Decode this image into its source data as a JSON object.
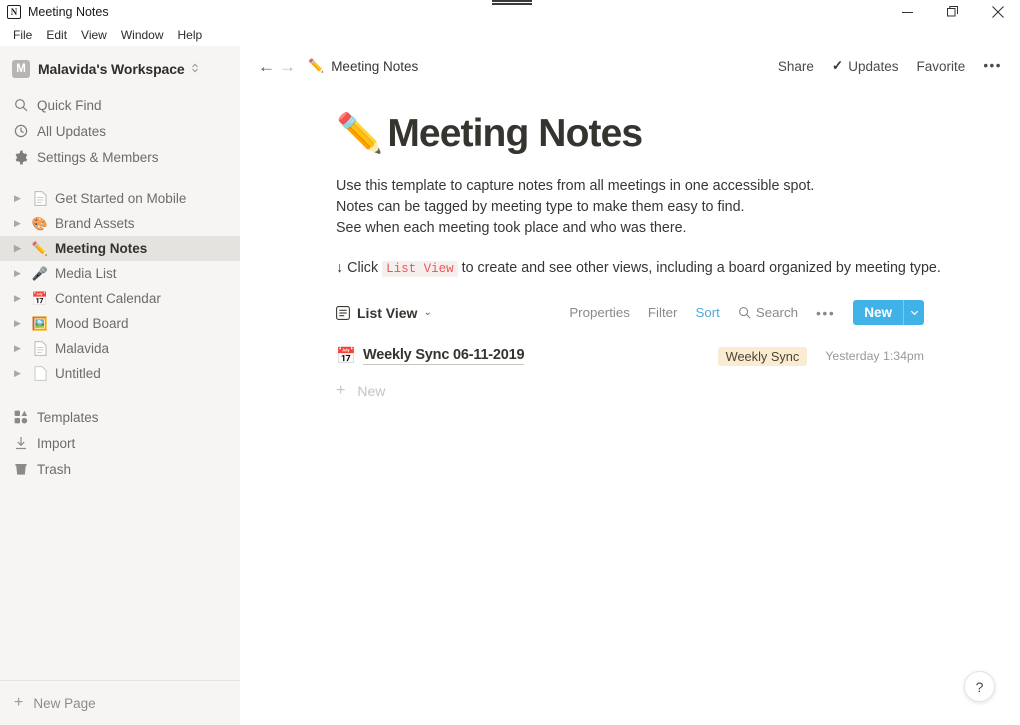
{
  "window": {
    "app_logo": "notion-n-logo",
    "title": "Meeting Notes",
    "minimize": "minimize-icon",
    "restore": "restore-icon",
    "close": "close-icon"
  },
  "menubar": {
    "items": [
      {
        "label": "File"
      },
      {
        "label": "Edit"
      },
      {
        "label": "View"
      },
      {
        "label": "Window"
      },
      {
        "label": "Help"
      }
    ]
  },
  "sidebar": {
    "workspace": {
      "avatar_letter": "M",
      "name": "Malavida's Workspace",
      "caret": "⌃⌄"
    },
    "nav": [
      {
        "label": "Quick Find",
        "icon": "search-icon"
      },
      {
        "label": "All Updates",
        "icon": "clock-icon"
      },
      {
        "label": "Settings & Members",
        "icon": "gear-icon"
      }
    ],
    "pages": [
      {
        "label": "Get Started on Mobile",
        "icon": "page-icon",
        "selected": false
      },
      {
        "label": "Brand Assets",
        "icon": "palette-emoji",
        "selected": false
      },
      {
        "label": "Meeting Notes",
        "icon": "pencil-emoji",
        "selected": true
      },
      {
        "label": "Media List",
        "icon": "microphone-emoji",
        "selected": false
      },
      {
        "label": "Content Calendar",
        "icon": "calendar-emoji",
        "selected": false
      },
      {
        "label": "Mood Board",
        "icon": "framed-picture-emoji",
        "selected": false
      },
      {
        "label": "Malavida",
        "icon": "page-icon",
        "selected": false
      },
      {
        "label": "Untitled",
        "icon": "empty-page-icon",
        "selected": false
      }
    ],
    "tools": [
      {
        "label": "Templates",
        "icon": "templates-icon"
      },
      {
        "label": "Import",
        "icon": "import-icon"
      },
      {
        "label": "Trash",
        "icon": "trash-icon"
      }
    ],
    "new_page": {
      "label": "New Page",
      "icon": "plus-icon"
    }
  },
  "topbar": {
    "back": "arrow-left-icon",
    "forward": "arrow-right-icon",
    "breadcrumb_emoji": "pencil-emoji",
    "breadcrumb": "Meeting Notes",
    "share": "Share",
    "updates": "Updates",
    "updates_check": "✓",
    "favorite": "Favorite",
    "more": "•••"
  },
  "page": {
    "emoji": "pencil-emoji",
    "title": "Meeting Notes",
    "description": [
      "Use this template to capture notes from all meetings in one accessible spot.",
      "Notes can be tagged by meeting type to make them easy to find.",
      "See when each meeting took place and who was there."
    ],
    "hint": {
      "prefix": "↓ Click",
      "code": "List View",
      "suffix": "to create and see other views, including a board organized by meeting type."
    }
  },
  "database": {
    "view": {
      "label": "List View",
      "icon": "list-view-icon",
      "caret": "⌄"
    },
    "actions": [
      {
        "label": "Properties",
        "active": false
      },
      {
        "label": "Filter",
        "active": false
      },
      {
        "label": "Sort",
        "active": true
      },
      {
        "label": "Search",
        "active": false,
        "icon": "search-icon"
      }
    ],
    "more": "•••",
    "new_button": {
      "label": "New",
      "caret": "⌄",
      "color": "#40b2e8"
    },
    "rows": [
      {
        "icon": "calendar-emoji",
        "title": "Weekly Sync 06-11-2019",
        "tag": "Weekly Sync",
        "tag_bg": "#faebd2",
        "time": "Yesterday 1:34pm"
      }
    ],
    "new_row": {
      "label": "New",
      "icon": "plus-icon"
    }
  },
  "help": {
    "label": "?"
  }
}
